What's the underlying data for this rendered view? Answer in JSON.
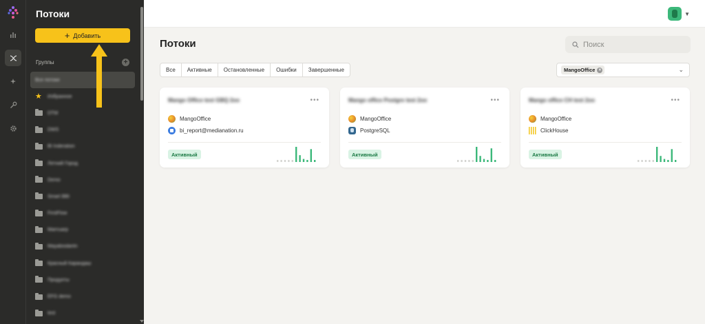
{
  "sidebar": {
    "title": "Потоки",
    "add_button": "Добавить",
    "groups_label": "Группы",
    "groups": [
      {
        "label": "Все потоки",
        "icon": "none",
        "selected": true
      },
      {
        "label": "Избранное",
        "icon": "star-icon"
      },
      {
        "label": "DTM",
        "icon": "folder-icon"
      },
      {
        "label": "DWS",
        "icon": "folder-icon"
      },
      {
        "label": "BI Inderation",
        "icon": "folder-icon"
      },
      {
        "label": "Летний Город",
        "icon": "folder-icon"
      },
      {
        "label": "Demo",
        "icon": "folder-icon"
      },
      {
        "label": "Smart BBI",
        "icon": "folder-icon"
      },
      {
        "label": "FirstFlow",
        "icon": "folder-icon"
      },
      {
        "label": "Marnuarp",
        "icon": "folder-icon"
      },
      {
        "label": "Mayabisdantn",
        "icon": "folder-icon"
      },
      {
        "label": "Красный Карандаш",
        "icon": "folder-icon"
      },
      {
        "label": "Продукты",
        "icon": "folder-icon"
      },
      {
        "label": "EFG demo",
        "icon": "folder-icon"
      },
      {
        "label": "test",
        "icon": "folder-icon"
      }
    ]
  },
  "rail": {
    "icons": [
      "chart-icon",
      "flows-icon",
      "sparkle-icon",
      "key-icon",
      "gear-icon"
    ],
    "active": "flows-icon"
  },
  "main": {
    "title": "Потоки",
    "search_placeholder": "Поиск",
    "tabs": [
      {
        "label": "Все",
        "active": true
      },
      {
        "label": "Активные"
      },
      {
        "label": "Остановленные"
      },
      {
        "label": "Ошибки"
      },
      {
        "label": "Завершенные"
      }
    ],
    "filter_chip": "MangoOffice"
  },
  "cards": [
    {
      "title": "Mango Office test GBQ 2oo",
      "source": "MangoOffice",
      "source_icon": "mango-icon",
      "target": "bi_report@medianation.ru",
      "target_icon": "google-analytics-icon",
      "status": "Активный",
      "activity": [
        0,
        0,
        0,
        0,
        0,
        1,
        0.45,
        0.2,
        0.1,
        0.85,
        0.1
      ]
    },
    {
      "title": "Mango office Postgre test 2oo",
      "source": "MangoOffice",
      "source_icon": "mango-icon",
      "target": "PostgreSQL",
      "target_icon": "postgresql-icon",
      "status": "Активный",
      "activity": [
        0,
        0,
        0,
        0,
        0,
        1,
        0.4,
        0.2,
        0.12,
        0.9,
        0.1
      ]
    },
    {
      "title": "Mango office CH test 2oo",
      "source": "MangoOffice",
      "source_icon": "mango-icon",
      "target": "ClickHouse",
      "target_icon": "clickhouse-icon",
      "status": "Активный",
      "activity": [
        0,
        0,
        0,
        0,
        0,
        1,
        0.4,
        0.2,
        0.12,
        0.85,
        0.1
      ]
    }
  ],
  "colors": {
    "accent": "#f7c21a",
    "sidebar_bg": "#2b2b29",
    "active_green": "#3cb87a",
    "spark_idle": "#d5d5d2"
  }
}
